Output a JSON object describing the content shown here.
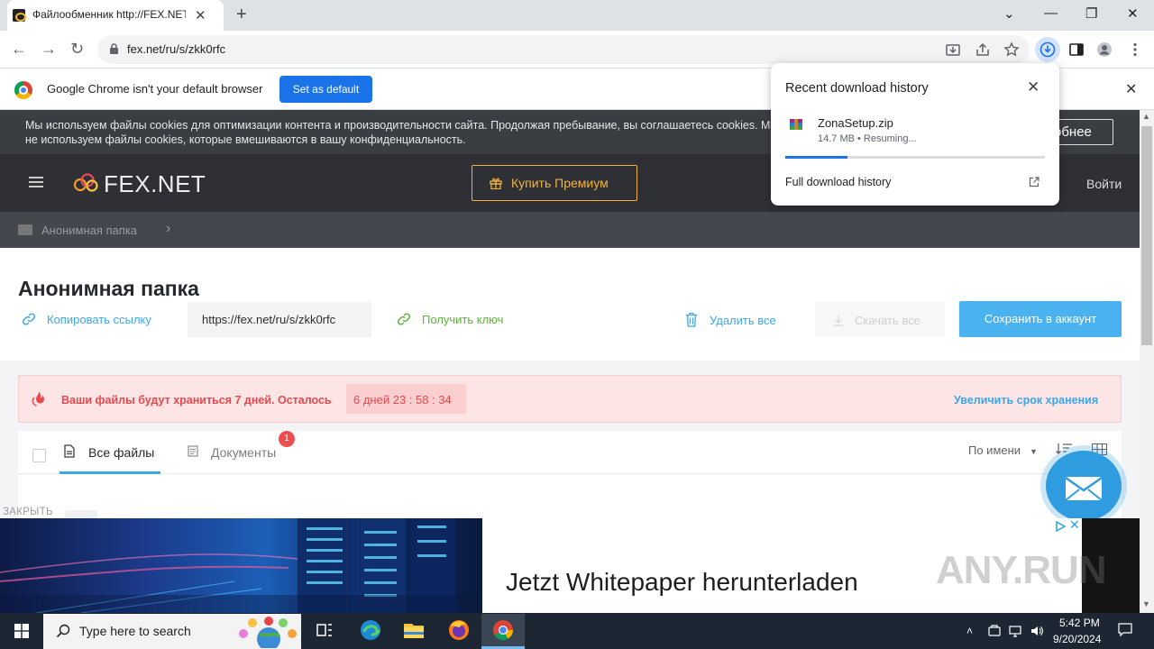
{
  "browser": {
    "tab_title": "Файлообменник http://FEX.NET",
    "tab_close": "✕",
    "new_tab": "+",
    "window_controls": {
      "dropdown": "⌄",
      "minimize": "—",
      "restore": "❐",
      "close": "✕"
    },
    "nav": {
      "back": "←",
      "forward": "→",
      "reload": "↻"
    },
    "url": "fex.net/ru/s/zkk0rfc",
    "default_bar": {
      "text": "Google Chrome isn't your default browser",
      "button": "Set as default",
      "close": "✕"
    }
  },
  "download_popup": {
    "title": "Recent download history",
    "close": "✕",
    "file_name": "ZonaSetup.zip",
    "file_status": "14.7 MB • Resuming...",
    "progress_fraction": 0.24,
    "full_history": "Full download history"
  },
  "cookie_banner": {
    "text": "Мы используем файлы cookies для оптимизации контента и производительности сайта. Продолжая пребывание, вы соглашаетесь cookies. Мы не используем файлы cookies, которые вмешиваются в вашу конфиденциальность.",
    "more_button": "обнее"
  },
  "site_header": {
    "logo_text": "FEX.NET",
    "premium_button": "Купить Премиум",
    "login": "Войти"
  },
  "breadcrumb": {
    "folder": "Анонимная папка",
    "chevron": "›"
  },
  "main": {
    "title": "Анонимная папка",
    "copy_link": "Копировать ссылку",
    "share_url": "https://fex.net/ru/s/zkk0rfc",
    "get_key": "Получить ключ",
    "delete_all": "Удалить все",
    "download_all": "Скачать все",
    "save_account": "Сохранить в аккаунт"
  },
  "alert": {
    "text": "Ваши файлы будут храниться 7 дней. Осталось",
    "timer": "6 дней  23 : 58 : 34",
    "extend": "Увеличить срок хранения"
  },
  "files": {
    "tab_all": "Все файлы",
    "tab_docs": "Документы",
    "docs_badge": "1",
    "sort_label": "По имени",
    "sort_caret": "▼"
  },
  "close_label": "ЗАКРЫТЬ",
  "ad": {
    "headline": "Jetzt Whitepaper herunterladen",
    "close": "✕",
    "watermark": "ANY.RUN"
  },
  "scrollbar": {
    "up": "▲",
    "down": "▼"
  },
  "taskbar": {
    "search_placeholder": "Type here to search",
    "tray_chevron": "˄",
    "time": "5:42 PM",
    "date": "9/20/2024"
  }
}
